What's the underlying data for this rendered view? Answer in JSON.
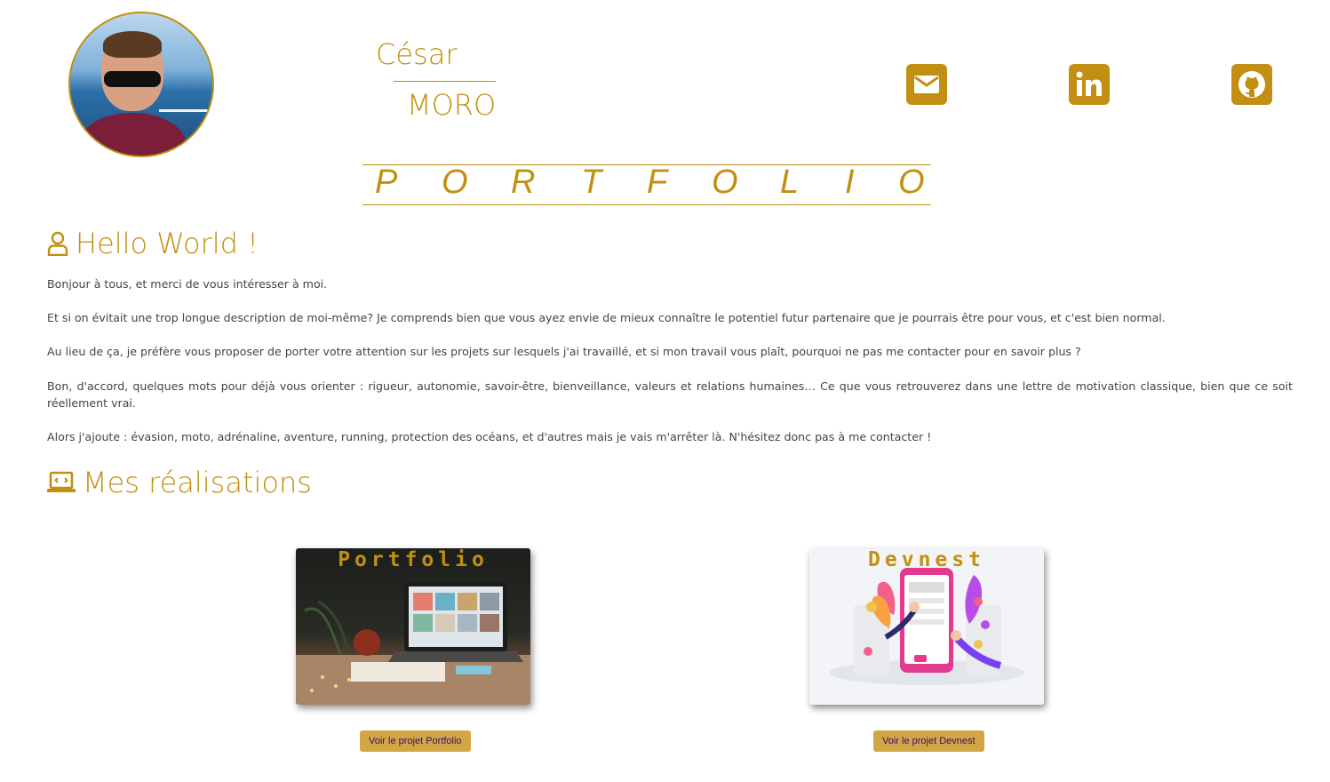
{
  "header": {
    "first_name": "César",
    "last_name": "MORO",
    "banner_letters": [
      "P",
      "O",
      "R",
      "T",
      "F",
      "O",
      "L",
      "I",
      "O"
    ],
    "social": [
      {
        "name": "email-link",
        "icon": "envelope-icon"
      },
      {
        "name": "linkedin-link",
        "icon": "linkedin-icon"
      },
      {
        "name": "github-link",
        "icon": "github-icon"
      }
    ]
  },
  "about": {
    "title": "Hello World !",
    "icon": "user-icon",
    "paragraphs": [
      "Bonjour à tous, et merci de vous intéresser à moi.",
      "Et si on évitait une trop longue description de moi-même? Je comprends bien que vous ayez envie de mieux connaître le potentiel futur partenaire que je pourrais être pour vous, et c'est bien normal.",
      "Au lieu de ça, je préfère vous proposer de porter votre attention sur les projets sur lesquels j'ai travaillé, et si mon travail vous plaît, pourquoi ne pas me contacter pour en savoir plus ?",
      "Bon, d'accord, quelques mots pour déjà vous orienter : rigueur, autonomie, savoir-être, bienveillance, valeurs et relations humaines… Ce que vous retrouverez dans une lettre de motivation classique, bien que ce soit réellement vrai.",
      "Alors j'ajoute : évasion, moto, adrénaline, aventure, running, protection des océans, et d'autres mais je vais m'arrêter là. N'hésitez donc pas à me contacter !"
    ]
  },
  "projects": {
    "title": "Mes réalisations",
    "icon": "laptop-code-icon",
    "items": [
      {
        "card_title": "Portfolio",
        "button": "Voir le projet Portfolio"
      },
      {
        "card_title": "Devnest",
        "button": "Voir le projet Devnest"
      }
    ]
  },
  "colors": {
    "accent": "#c28f12",
    "button_bg": "#d2a645",
    "button_text": "#3b0b73",
    "body_text": "#444444"
  }
}
